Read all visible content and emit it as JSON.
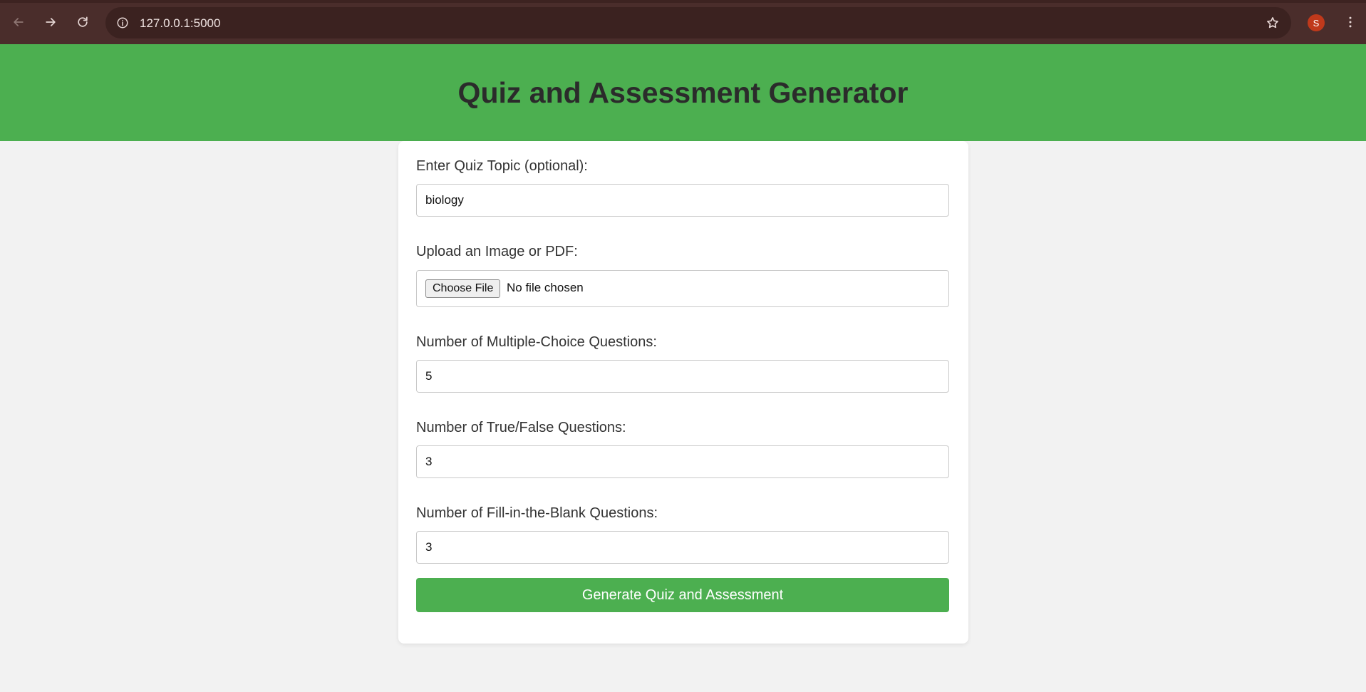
{
  "browser": {
    "url": "127.0.0.1:5000",
    "profile_initial": "S",
    "icons": {
      "back": "back-arrow-icon",
      "forward": "forward-arrow-icon",
      "reload": "reload-icon",
      "site_info": "info-icon",
      "bookmark": "star-icon",
      "menu": "kebab-menu-icon"
    }
  },
  "header": {
    "title": "Quiz and Assessment Generator",
    "background_color": "#4caf50"
  },
  "form": {
    "topic": {
      "label": "Enter Quiz Topic (optional):",
      "value": "biology"
    },
    "upload": {
      "label": "Upload an Image or PDF:",
      "button_label": "Choose File",
      "status": "No file chosen"
    },
    "mcq": {
      "label": "Number of Multiple-Choice Questions:",
      "value": "5"
    },
    "true_false": {
      "label": "Number of True/False Questions:",
      "value": "3"
    },
    "fill_blank": {
      "label": "Number of Fill-in-the-Blank Questions:",
      "value": "3"
    },
    "submit_label": "Generate Quiz and Assessment"
  }
}
